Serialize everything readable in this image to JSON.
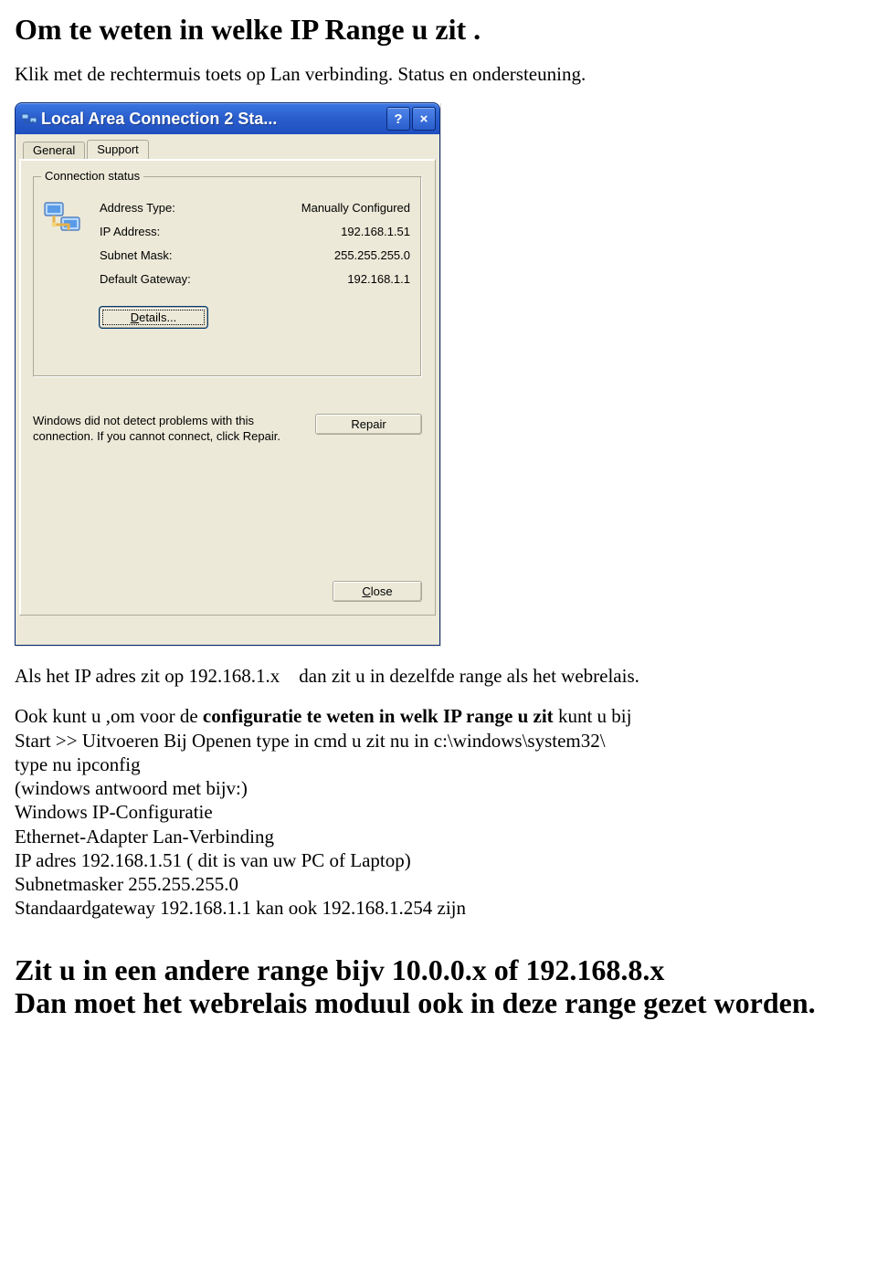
{
  "heading": "Om te weten in welke IP Range u zit .",
  "intro": "Klik met de rechtermuis toets op Lan verbinding. Status en ondersteuning.",
  "dialog": {
    "title": "Local Area Connection 2 Sta...",
    "help_glyph": "?",
    "close_glyph": "×",
    "tabs": {
      "general": "General",
      "support": "Support"
    },
    "group_title": "Connection status",
    "rows": {
      "address_type": {
        "label": "Address Type:",
        "value": "Manually Configured"
      },
      "ip_address": {
        "label": "IP Address:",
        "value": "192.168.1.51"
      },
      "subnet_mask": {
        "label": "Subnet Mask:",
        "value": "255.255.255.0"
      },
      "gateway": {
        "label": "Default Gateway:",
        "value": "192.168.1.1"
      }
    },
    "details_label": "Details...",
    "diag_text": "Windows did not detect problems with this connection. If you cannot connect, click Repair.",
    "repair_label": "Repair",
    "close_label": "Close"
  },
  "after1_a": "Als het IP adres zit op 192.168.1.x",
  "after1_b": "dan zit u in dezelfde range als het webrelais.",
  "after2": {
    "l1a": "Ook kunt u ,om voor de ",
    "l1b": "configuratie te weten in welk IP range u zit",
    "l1c": " kunt u bij",
    "l2": "Start >> Uitvoeren Bij Openen type in cmd u zit nu in c:\\windows\\system32\\",
    "l3": "type nu ipconfig",
    "l4": "(windows antwoord met bijv:)",
    "l5": "Windows IP-Configuratie",
    "l6": "Ethernet-Adapter Lan-Verbinding",
    "l7": "IP adres 192.168.1.51   ( dit is van uw PC of Laptop)",
    "l8": "Subnetmasker 255.255.255.0",
    "l9": "Standaardgateway 192.168.1.1   kan ook 192.168.1.254 zijn"
  },
  "footer": {
    "l1": "Zit u in een andere range bijv 10.0.0.x  of 192.168.8.x",
    "l2": "Dan moet het webrelais moduul ook in deze range gezet worden."
  }
}
